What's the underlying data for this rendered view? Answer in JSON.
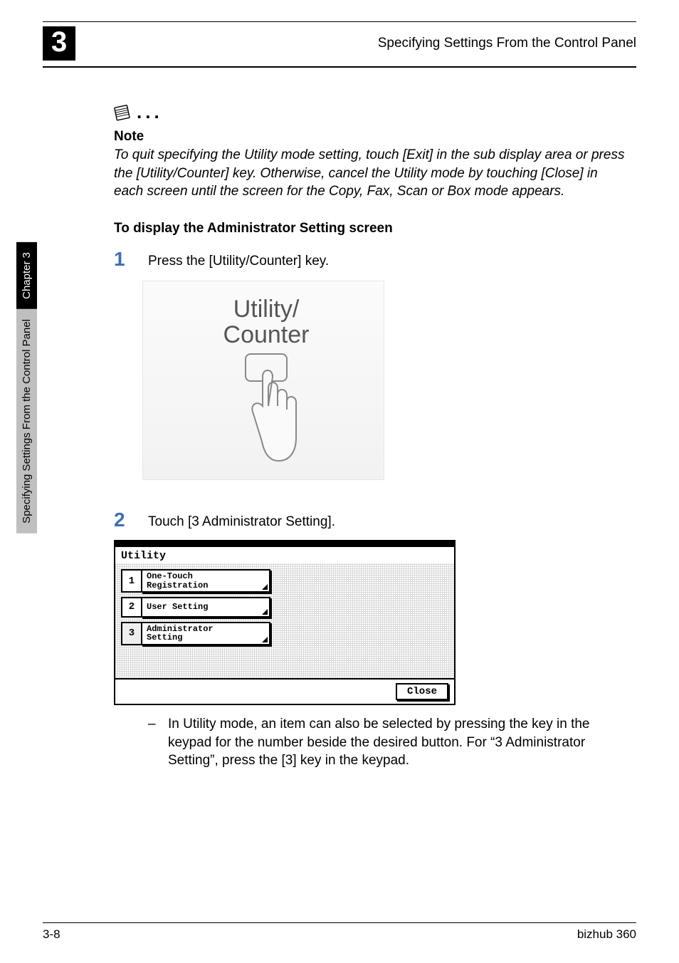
{
  "header": {
    "chapter_num": "3",
    "title": "Specifying Settings From the Control Panel"
  },
  "side_tab": {
    "chapter_label": "Chapter 3",
    "section_label": "Specifying Settings From the Control Panel"
  },
  "note": {
    "title": "Note",
    "body": "To quit specifying the Utility mode setting, touch [Exit] in the sub display area or press the [Utility/Counter] key. Otherwise, cancel the Utility mode by touching [Close] in each screen until the screen for the Copy, Fax, Scan or Box mode appears."
  },
  "section_title": "To display the Administrator Setting screen",
  "steps": [
    {
      "num": "1",
      "text": "Press the [Utility/Counter] key."
    },
    {
      "num": "2",
      "text": "Touch [3 Administrator Setting]."
    }
  ],
  "illustration": {
    "line1": "Utility/",
    "line2": "Counter"
  },
  "menu": {
    "title": "Utility",
    "rows": [
      {
        "num": "1",
        "label_l1": "One-Touch",
        "label_l2": "Registration"
      },
      {
        "num": "2",
        "label_l1": "User Setting",
        "label_l2": ""
      },
      {
        "num": "3",
        "label_l1": "Administrator",
        "label_l2": "Setting"
      }
    ],
    "close": "Close"
  },
  "bullet": "In Utility mode, an item can also be selected by pressing the key in the keypad for the number beside the desired button. For “3 Administrator Setting”, press the [3] key in the keypad.",
  "footer": {
    "left": "3-8",
    "right": "bizhub 360"
  },
  "chart_data": null
}
